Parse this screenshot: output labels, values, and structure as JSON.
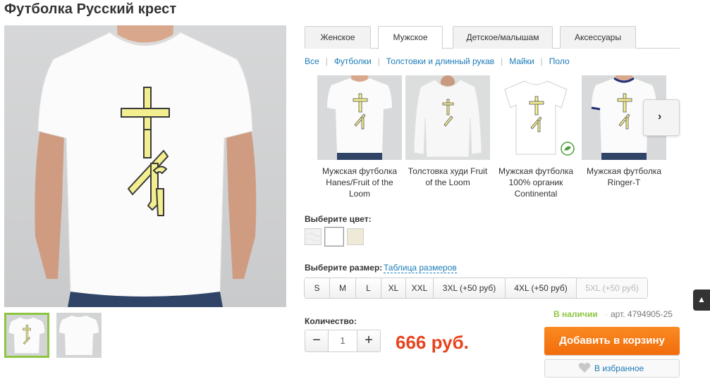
{
  "title": "Футболка Русский крест",
  "tabs": [
    {
      "label": "Женское",
      "active": false
    },
    {
      "label": "Мужское",
      "active": true
    },
    {
      "label": "Детское/малышам",
      "active": false
    },
    {
      "label": "Аксессуары",
      "active": false
    }
  ],
  "categories": [
    "Все",
    "Футболки",
    "Толстовки и длинный рукав",
    "Майки",
    "Поло"
  ],
  "product_types": [
    {
      "label": "Мужская футболка Hanes/Fruit of the Loom"
    },
    {
      "label": "Толстовка худи Fruit of the Loom"
    },
    {
      "label": "Мужская футболка 100% органик Continental"
    },
    {
      "label": "Мужская футболка Ringer-T"
    }
  ],
  "next_arrow": "›",
  "color": {
    "label": "Выберите цвет:",
    "swatches": [
      {
        "name": "marble-white",
        "hex": "#f1f1f1"
      },
      {
        "name": "white",
        "hex": "#ffffff",
        "selected": true
      },
      {
        "name": "cream",
        "hex": "#efead7"
      }
    ]
  },
  "size": {
    "label": "Выберите размер:",
    "table_link": "Таблица размеров",
    "options": [
      {
        "label": "S",
        "disabled": false
      },
      {
        "label": "M",
        "disabled": false
      },
      {
        "label": "L",
        "disabled": false
      },
      {
        "label": "XL",
        "disabled": false
      },
      {
        "label": "XXL",
        "disabled": false
      },
      {
        "label": "3XL (+50 руб)",
        "disabled": false
      },
      {
        "label": "4XL (+50 руб)",
        "disabled": false
      },
      {
        "label": "5XL (+50 руб)",
        "disabled": true
      }
    ]
  },
  "stock": {
    "status": "В наличии",
    "separator": "·",
    "article": "арт. 4794905-25"
  },
  "quantity": {
    "label": "Количество:",
    "minus": "−",
    "value": "1",
    "plus": "+"
  },
  "price": "666 руб.",
  "buttons": {
    "add_to_cart": "Добавить в корзину",
    "favorites": "В избранное"
  },
  "scroll_top": "▲",
  "colors": {
    "accent_green": "#8cc63f",
    "link_blue": "#1a7bb8",
    "price_red": "#e8431f",
    "cart_orange": "#f57b16",
    "print_yellow": "#f3ee8f"
  }
}
